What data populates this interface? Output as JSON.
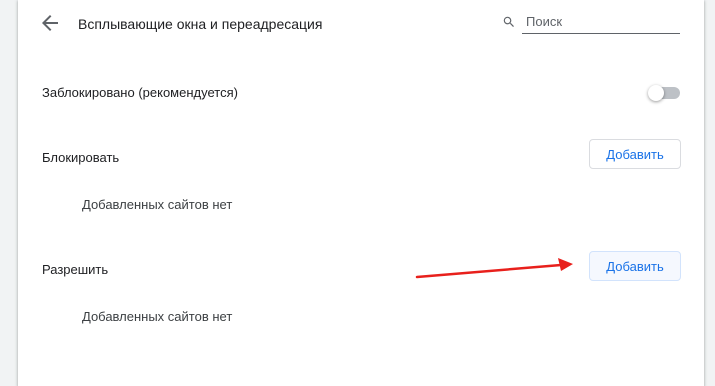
{
  "header": {
    "title": "Всплывающие окна и переадресация",
    "back_icon": "arrow-left-icon",
    "search": {
      "placeholder": "Поиск",
      "value": "",
      "icon": "search-icon"
    }
  },
  "blocked_setting": {
    "label": "Заблокировано (рекомендуется)",
    "toggle_on": false
  },
  "sections": {
    "block": {
      "title": "Блокировать",
      "add_label": "Добавить",
      "empty_text": "Добавленных сайтов нет"
    },
    "allow": {
      "title": "Разрешить",
      "add_label": "Добавить",
      "empty_text": "Добавленных сайтов нет"
    }
  },
  "colors": {
    "accent": "#1a73e8",
    "annotation_arrow": "#e8201c",
    "toggle_off_track": "#bdc1c6"
  }
}
